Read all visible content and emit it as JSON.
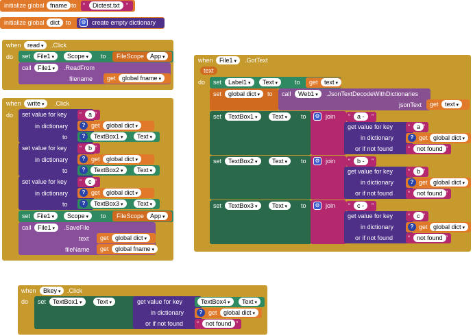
{
  "globals": {
    "init_label": "initialize global",
    "to": "to",
    "fname_var": "fname",
    "fname_value": "Dictest.txt",
    "dict_var": "dict",
    "create_dict": "create empty dictionary"
  },
  "kw": {
    "when": "when",
    "do": "do",
    "set": "set",
    "to": "to",
    "call": "call",
    "click": ".Click",
    "set_value_for_key": "set value for key",
    "in_dictionary": "in dictionary",
    "get_value_for_key": "get value for key",
    "or_if_not_found": "or if not found",
    "get": "get",
    "join": "join",
    "text": "text",
    "filename_cap": "fileName",
    "filename_lower": "filename"
  },
  "read_event": {
    "component": "read",
    "file": "File1",
    "scope_prop": "Scope",
    "scope_value_prefix": "FileScope",
    "scope_value": "App",
    "method": ".ReadFrom",
    "arg_var": "global fname"
  },
  "write_event": {
    "component": "write",
    "keys": [
      "a",
      "b",
      "c"
    ],
    "dict_var": "global dict",
    "textboxes": [
      "TextBox1",
      "TextBox2",
      "TextBox3"
    ],
    "text_prop": "Text",
    "file": "File1",
    "scope_prop": "Scope",
    "scope_value_prefix": "FileScope",
    "scope_value": "App",
    "method": ".SaveFile",
    "arg_text_var": "global dict",
    "arg_file_var": "global fname"
  },
  "gottext_event": {
    "component": "File1",
    "event": ".GotText",
    "param": "text",
    "label": "Label1",
    "text_prop": "Text",
    "text_var": "text",
    "dict_var": "global dict",
    "web": "Web1",
    "web_method": ".JsonTextDecodeWithDictionaries",
    "web_arg": "jsonText",
    "rows": [
      {
        "textbox": "TextBox1",
        "prefix": "a -",
        "key": "a",
        "not_found": "not found"
      },
      {
        "textbox": "TextBox2",
        "prefix": "b -",
        "key": "b",
        "not_found": "not found"
      },
      {
        "textbox": "TextBox3",
        "prefix": "c -",
        "key": "c",
        "not_found": "not found"
      }
    ]
  },
  "bkey_event": {
    "component": "Bkey",
    "target": "TextBox1",
    "text_prop": "Text",
    "key_source": "TextBox4",
    "key_prop": "Text",
    "dict_var": "global dict",
    "not_found": "not found"
  }
}
